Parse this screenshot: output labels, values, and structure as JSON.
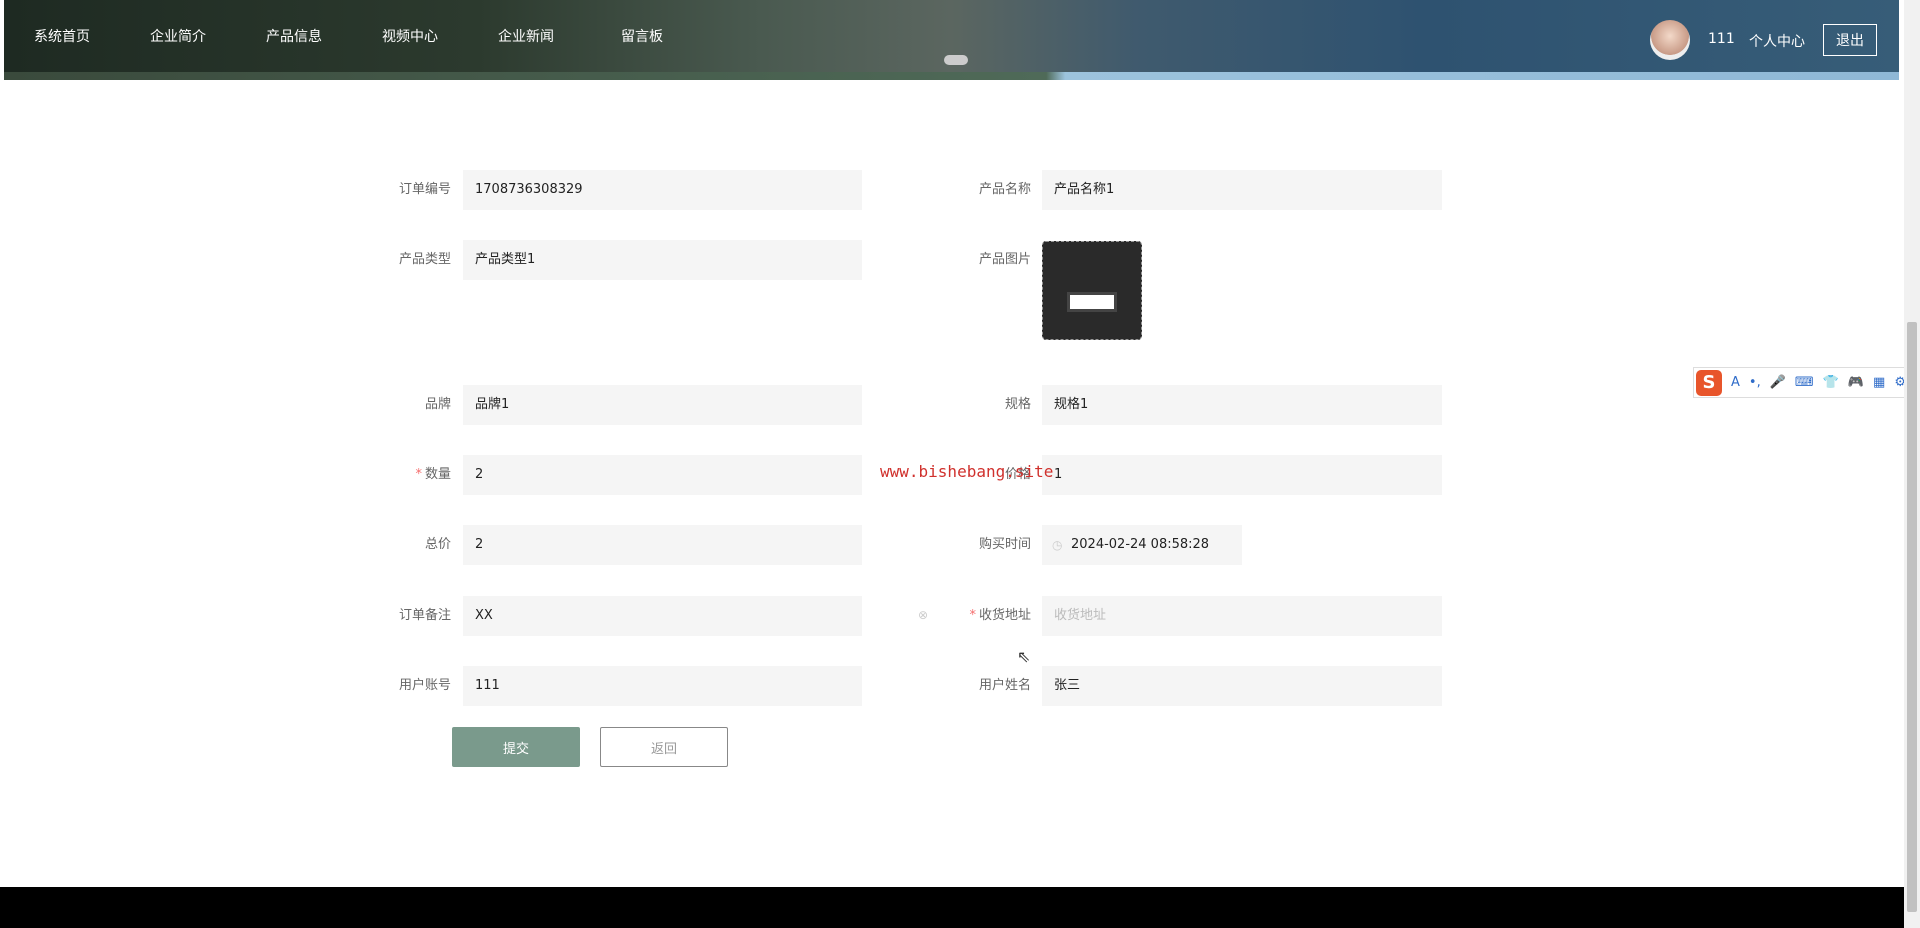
{
  "nav": {
    "items": [
      "系统首页",
      "企业简介",
      "产品信息",
      "视频中心",
      "企业新闻",
      "留言板"
    ],
    "username": "111",
    "profile": "个人中心",
    "logout": "退出"
  },
  "form": {
    "order_no": {
      "label": "订单编号",
      "value": "1708736308329"
    },
    "product_name": {
      "label": "产品名称",
      "value": "产品名称1"
    },
    "product_type": {
      "label": "产品类型",
      "value": "产品类型1"
    },
    "product_image": {
      "label": "产品图片"
    },
    "brand": {
      "label": "品牌",
      "value": "品牌1"
    },
    "spec": {
      "label": "规格",
      "value": "规格1"
    },
    "quantity": {
      "label": "数量",
      "value": "2",
      "required": "*"
    },
    "price": {
      "label": "价格",
      "value": "1"
    },
    "total": {
      "label": "总价",
      "value": "2"
    },
    "purchase_time": {
      "label": "购买时间",
      "value": "2024-02-24 08:58:28"
    },
    "remark": {
      "label": "订单备注",
      "value": "XX"
    },
    "address": {
      "label": "收货地址",
      "placeholder": "收货地址",
      "required": "*"
    },
    "account": {
      "label": "用户账号",
      "value": "111"
    },
    "user_name": {
      "label": "用户姓名",
      "value": "张三"
    },
    "submit": "提交",
    "back": "返回"
  },
  "watermark": "www.bishebang.site",
  "ime": {
    "logo": "S",
    "items": [
      "A",
      "•,",
      "🎤",
      "⌨",
      "👕",
      "🎮",
      "▦",
      "⚙"
    ]
  }
}
